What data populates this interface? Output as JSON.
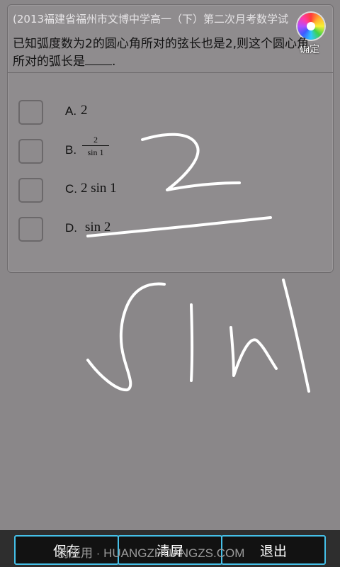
{
  "header": {
    "source": "(2013福建省福州市文博中学高一（下）第二次月考数学试",
    "question_before_blank": "已知弧度数为2的圆心角所对的弦长也是2,则这个圆心角所对的弧长是",
    "question_after_blank": ".",
    "confirm_label": "确定"
  },
  "options": [
    {
      "letter": "A.",
      "value": "2"
    },
    {
      "letter": "B.",
      "numerator": "2",
      "denominator": "sin 1"
    },
    {
      "letter": "C.",
      "value": "2 sin 1"
    },
    {
      "letter": "D.",
      "value": "sin 2"
    }
  ],
  "buttons": {
    "save": "保存",
    "clear": "清屏",
    "exit": "退出"
  },
  "watermark": "创应用 · HUANGZHUANGZS.COM",
  "colors": {
    "background": "#8a8789",
    "button_border": "#45c0e8",
    "ink": "#ffffff"
  }
}
